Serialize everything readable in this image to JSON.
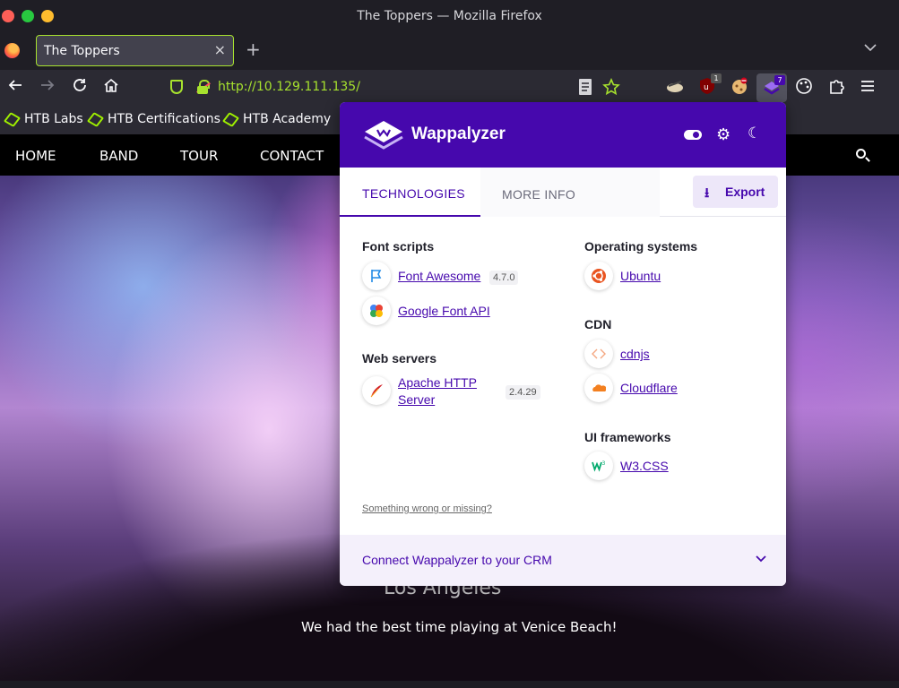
{
  "window": {
    "title": "The Toppers — Mozilla Firefox"
  },
  "tab": {
    "title": "The Toppers",
    "close": "×",
    "new": "+"
  },
  "nav": {
    "url": "http://10.129.111.135/"
  },
  "extensions": {
    "ublock_badge": "1",
    "wappalyzer_badge": "7"
  },
  "bookmarks": [
    "HTB Labs",
    "HTB Certifications",
    "HTB Academy"
  ],
  "site": {
    "nav": [
      "HOME",
      "BAND",
      "TOUR",
      "CONTACT"
    ],
    "city": "Los Angeles",
    "caption": "We had the best time playing at Venice Beach!"
  },
  "wappalyzer": {
    "title": "Wappalyzer",
    "tabs": {
      "technologies": "TECHNOLOGIES",
      "more_info": "MORE INFO"
    },
    "export_label": "Export",
    "categories": {
      "font_scripts": "Font scripts",
      "web_servers": "Web servers",
      "operating_systems": "Operating systems",
      "cdn": "CDN",
      "ui_frameworks": "UI frameworks"
    },
    "tech": {
      "font_awesome": {
        "name": "Font Awesome",
        "version": "4.7.0"
      },
      "google_font_api": {
        "name": "Google Font API"
      },
      "apache": {
        "name_line1": "Apache HTTP",
        "name_line2": "Server",
        "version": "2.4.29"
      },
      "ubuntu": {
        "name": "Ubuntu"
      },
      "cdnjs": {
        "name": "cdnjs"
      },
      "cloudflare": {
        "name": "Cloudflare"
      },
      "w3css": {
        "name": "W3.CSS"
      }
    },
    "wrong_link": "Something wrong or missing?",
    "footer": "Connect Wappalyzer to your CRM"
  },
  "colors": {
    "accent": "#4608ad",
    "url_green": "#a7e22e",
    "htb_green": "#9fef00"
  }
}
